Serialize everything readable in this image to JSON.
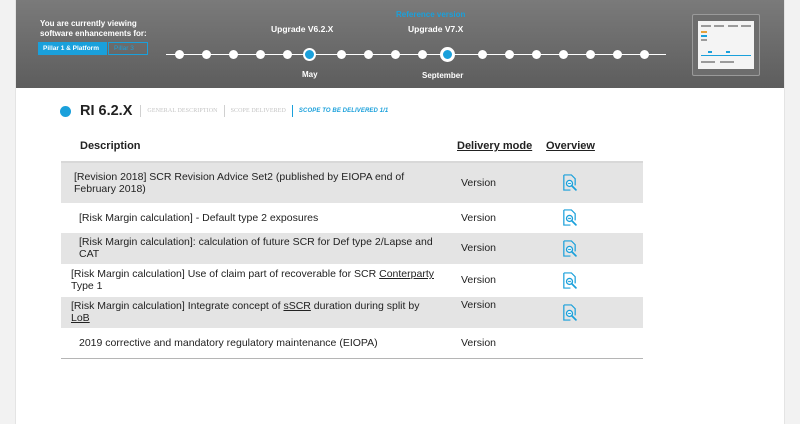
{
  "banner": {
    "viewing_text": "You are currently viewing software enhancements for:",
    "pill_active": "Pillar 1 & Platform",
    "pill_inactive": "Pillar 3",
    "upgrade_current": "Upgrade V6.2.X",
    "reference_label": "Reference version",
    "upgrade_next": "Upgrade  V7.X",
    "month_may": "May",
    "month_september": "September",
    "accent_color": "#1aa0db"
  },
  "section": {
    "title": "RI 6.2.X",
    "tabs": [
      "GENERAL DESCRIPTION",
      "SCOPE DELIVERED",
      "SCOPE TO BE DELIVERED 1/1"
    ],
    "active_tab": "SCOPE TO BE DELIVERED 1/1"
  },
  "table": {
    "headers": {
      "description": "Description",
      "delivery_mode": "Delivery mode",
      "overview": "Overview"
    },
    "rows": [
      {
        "description": "[Revision 2018] SCR Revision Advice Set2 (published by EIOPA end of February 2018)",
        "mode": "Version",
        "icon": "document-search-icon"
      },
      {
        "description": "[Risk Margin calculation] - Default type 2 exposures",
        "mode": "Version",
        "icon": "document-search-icon"
      },
      {
        "description": "[Risk Margin calculation]: calculation of future SCR for Def type 2/Lapse and CAT",
        "mode": "Version",
        "icon": "document-search-icon"
      },
      {
        "description_a": "[Risk Margin calculation] Use of claim part of recoverable for SCR ",
        "description_u": "Conterparty",
        "description_b": " Type 1",
        "mode": "Version",
        "icon": "document-search-icon"
      },
      {
        "description_a": "[Risk Margin calculation] Integrate concept of ",
        "description_u": "sSCR",
        "description_b": " duration during split by ",
        "description_u2": "LoB",
        "mode": "Version",
        "icon": "document-search-icon"
      },
      {
        "description": "2019 corrective and mandatory regulatory maintenance (EIOPA)",
        "mode": "Version"
      }
    ]
  }
}
